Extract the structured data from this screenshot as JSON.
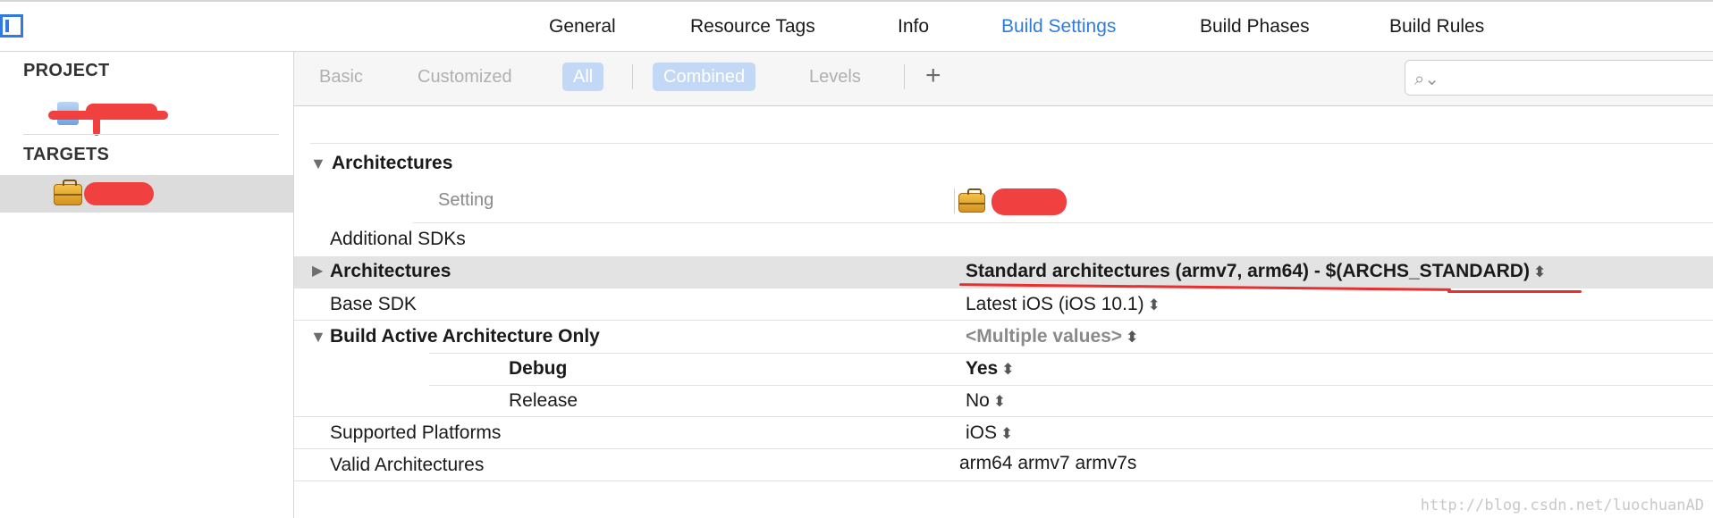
{
  "tabs": [
    {
      "label": "General"
    },
    {
      "label": "Resource Tags"
    },
    {
      "label": "Info"
    },
    {
      "label": "Build Settings"
    },
    {
      "label": "Build Phases"
    },
    {
      "label": "Build Rules"
    }
  ],
  "sidebar": {
    "project_title": "PROJECT",
    "targets_title": "TARGETS"
  },
  "filters": {
    "basic": "Basic",
    "customized": "Customized",
    "all": "All",
    "combined": "Combined",
    "levels": "Levels",
    "add": "+",
    "search_icon": "⌕⌄"
  },
  "settings": {
    "section": "Architectures",
    "setting_header": "Setting",
    "rows": {
      "additional_sdks": {
        "name": "Additional SDKs",
        "value": ""
      },
      "architectures": {
        "name": "Architectures",
        "value": "Standard architectures (armv7, arm64)  -  $(ARCHS_STANDARD)"
      },
      "base_sdk": {
        "name": "Base SDK",
        "value": "Latest iOS (iOS 10.1)"
      },
      "build_active": {
        "name": "Build Active Architecture Only",
        "value": "<Multiple values>"
      },
      "debug": {
        "name": "Debug",
        "value": "Yes"
      },
      "release": {
        "name": "Release",
        "value": "No"
      },
      "supported_platforms": {
        "name": "Supported Platforms",
        "value": "iOS"
      },
      "valid_archs": {
        "name": "Valid Architectures",
        "value": "arm64 armv7 armv7s"
      }
    }
  },
  "stepper_glyph": "⬍",
  "watermark": "http://blog.csdn.net/luochuanAD",
  "colors": {
    "accent": "#2f7be0",
    "annotation": "#e83030"
  }
}
